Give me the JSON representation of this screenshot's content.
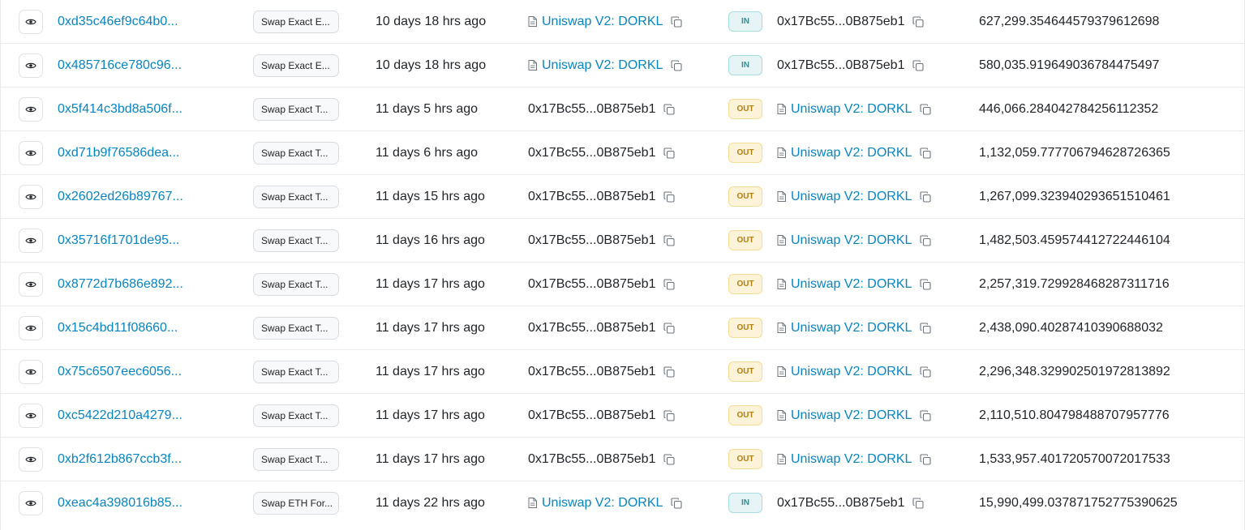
{
  "colors": {
    "link": "#0784c3",
    "in_badge_bg": "#e6f4f5",
    "in_badge_text": "#3b8b93",
    "out_badge_bg": "#fdf3d9",
    "out_badge_text": "#b57d0b"
  },
  "rows": [
    {
      "hash": "0xd35c46ef9c64b0...",
      "method": "Swap Exact E...",
      "age": "10 days 18 hrs ago",
      "from": "Uniswap V2: DORKL",
      "from_is_contract": true,
      "direction": "IN",
      "to": "0x17Bc55...0B875eb1",
      "to_is_contract": false,
      "amount": "627,299.354644579379612698"
    },
    {
      "hash": "0x485716ce780c96...",
      "method": "Swap Exact E...",
      "age": "10 days 18 hrs ago",
      "from": "Uniswap V2: DORKL",
      "from_is_contract": true,
      "direction": "IN",
      "to": "0x17Bc55...0B875eb1",
      "to_is_contract": false,
      "amount": "580,035.919649036784475497"
    },
    {
      "hash": "0x5f414c3bd8a506f...",
      "method": "Swap Exact T...",
      "age": "11 days 5 hrs ago",
      "from": "0x17Bc55...0B875eb1",
      "from_is_contract": false,
      "direction": "OUT",
      "to": "Uniswap V2: DORKL",
      "to_is_contract": true,
      "amount": "446,066.284042784256112352"
    },
    {
      "hash": "0xd71b9f76586dea...",
      "method": "Swap Exact T...",
      "age": "11 days 6 hrs ago",
      "from": "0x17Bc55...0B875eb1",
      "from_is_contract": false,
      "direction": "OUT",
      "to": "Uniswap V2: DORKL",
      "to_is_contract": true,
      "amount": "1,132,059.777706794628726365"
    },
    {
      "hash": "0x2602ed26b89767...",
      "method": "Swap Exact T...",
      "age": "11 days 15 hrs ago",
      "from": "0x17Bc55...0B875eb1",
      "from_is_contract": false,
      "direction": "OUT",
      "to": "Uniswap V2: DORKL",
      "to_is_contract": true,
      "amount": "1,267,099.323940293651510461"
    },
    {
      "hash": "0x35716f1701de95...",
      "method": "Swap Exact T...",
      "age": "11 days 16 hrs ago",
      "from": "0x17Bc55...0B875eb1",
      "from_is_contract": false,
      "direction": "OUT",
      "to": "Uniswap V2: DORKL",
      "to_is_contract": true,
      "amount": "1,482,503.459574412722446104"
    },
    {
      "hash": "0x8772d7b686e892...",
      "method": "Swap Exact T...",
      "age": "11 days 17 hrs ago",
      "from": "0x17Bc55...0B875eb1",
      "from_is_contract": false,
      "direction": "OUT",
      "to": "Uniswap V2: DORKL",
      "to_is_contract": true,
      "amount": "2,257,319.729928468287311716"
    },
    {
      "hash": "0x15c4bd11f08660...",
      "method": "Swap Exact T...",
      "age": "11 days 17 hrs ago",
      "from": "0x17Bc55...0B875eb1",
      "from_is_contract": false,
      "direction": "OUT",
      "to": "Uniswap V2: DORKL",
      "to_is_contract": true,
      "amount": "2,438,090.40287410390688032"
    },
    {
      "hash": "0x75c6507eec6056...",
      "method": "Swap Exact T...",
      "age": "11 days 17 hrs ago",
      "from": "0x17Bc55...0B875eb1",
      "from_is_contract": false,
      "direction": "OUT",
      "to": "Uniswap V2: DORKL",
      "to_is_contract": true,
      "amount": "2,296,348.329902501972813892"
    },
    {
      "hash": "0xc5422d210a4279...",
      "method": "Swap Exact T...",
      "age": "11 days 17 hrs ago",
      "from": "0x17Bc55...0B875eb1",
      "from_is_contract": false,
      "direction": "OUT",
      "to": "Uniswap V2: DORKL",
      "to_is_contract": true,
      "amount": "2,110,510.804798488707957776"
    },
    {
      "hash": "0xb2f612b867ccb3f...",
      "method": "Swap Exact T...",
      "age": "11 days 17 hrs ago",
      "from": "0x17Bc55...0B875eb1",
      "from_is_contract": false,
      "direction": "OUT",
      "to": "Uniswap V2: DORKL",
      "to_is_contract": true,
      "amount": "1,533,957.401720570072017533"
    },
    {
      "hash": "0xeac4a398016b85...",
      "method": "Swap ETH For...",
      "age": "11 days 22 hrs ago",
      "from": "Uniswap V2: DORKL",
      "from_is_contract": true,
      "direction": "IN",
      "to": "0x17Bc55...0B875eb1",
      "to_is_contract": false,
      "amount": "15,990,499.037871752775390625"
    }
  ]
}
